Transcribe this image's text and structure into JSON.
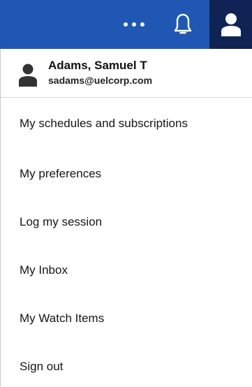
{
  "topbar": {
    "more_icon": "more-horizontal-icon",
    "notifications_icon": "bell-icon",
    "user_icon": "user-icon"
  },
  "profile": {
    "name": "Adams, Samuel T",
    "email": "sadams@uelcorp.com",
    "avatar_icon": "user-avatar-icon"
  },
  "menu": {
    "items": [
      {
        "label": "My schedules and subscriptions"
      },
      {
        "label": "My preferences"
      },
      {
        "label": "Log my session"
      },
      {
        "label": "My Inbox"
      },
      {
        "label": "My Watch Items"
      },
      {
        "label": "Sign out"
      }
    ]
  },
  "colors": {
    "topbar_bg": "#1f57b3",
    "user_button_bg": "#0f2454",
    "text": "#161616"
  }
}
